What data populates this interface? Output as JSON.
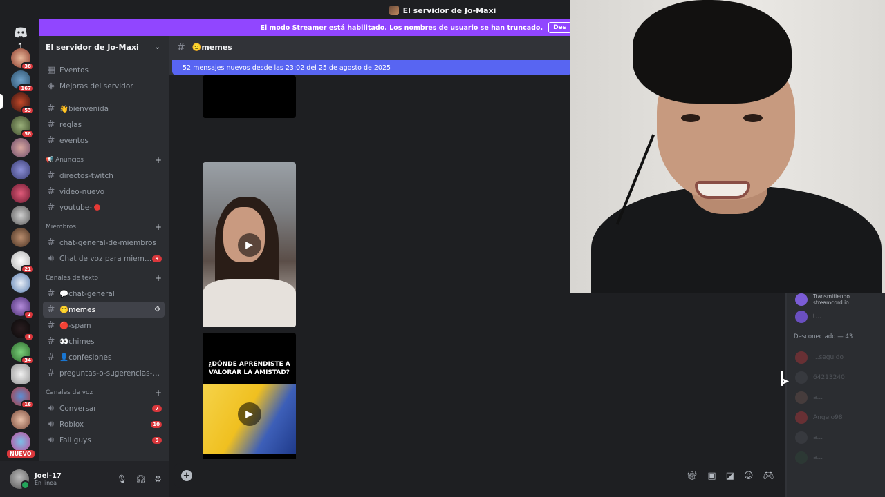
{
  "window": {
    "title": "El servidor de Jo-Maxi"
  },
  "banner": {
    "text": "El modo Streamer está habilitado. Los nombres de usuario se han truncado.",
    "button": "Des"
  },
  "rail": {
    "badges": [
      "1",
      "38",
      "167",
      "53",
      "58",
      "21",
      "2",
      "1",
      "34",
      "16"
    ],
    "new_label": "NUEVO"
  },
  "server": {
    "name": "El servidor de Jo-Maxi"
  },
  "sidebar": {
    "top_items": [
      {
        "label": "Eventos",
        "icon": "calendar-icon"
      },
      {
        "label": "Mejoras del servidor",
        "icon": "boost-icon"
      }
    ],
    "channels_top": [
      {
        "label": "👋bienvenida"
      },
      {
        "label": "reglas"
      },
      {
        "label": "eventos"
      }
    ],
    "categories": {
      "anuncios": "📢 Anuncios",
      "miembros": "Miembros",
      "texto": "Canales de texto",
      "voz": "Canales de voz"
    },
    "anuncios": [
      {
        "label": "directos-twitch"
      },
      {
        "label": "video-nuevo"
      },
      {
        "label": "youtube-"
      }
    ],
    "miembros": [
      {
        "label": "chat-general-de-miembros"
      },
      {
        "label": "Chat de voz para miemb...",
        "badge": "9"
      }
    ],
    "texto": [
      {
        "label": "💬chat-general"
      },
      {
        "label": "🙂memes"
      },
      {
        "label": "🔴-spam"
      },
      {
        "label": "👀chimes"
      },
      {
        "label": "👤confesiones"
      },
      {
        "label": "preguntas-o-sugerencias-pa..."
      }
    ],
    "voz": [
      {
        "label": "Conversar",
        "badge": "7"
      },
      {
        "label": "Roblox",
        "badge": "10"
      },
      {
        "label": "Fall guys",
        "badge": "9"
      }
    ]
  },
  "user": {
    "name": "Joel-17",
    "status": "En línea"
  },
  "channel": {
    "name": "🙂memes"
  },
  "new_messages": "52 mensajes nuevos desde las 23:02 del 25 de agosto de 2025",
  "media": {
    "m3_title": "¿DÓNDE APRENDISTE A VALORAR LA AMISTAD?"
  },
  "members": {
    "streaming": "Transmitiendo streamcord.io",
    "online_name": "t...",
    "offline_header": "Desconectado — 43",
    "offline": [
      {
        "name": "...seguido",
        "color": "#da373c"
      },
      {
        "name": "64213240",
        "color": "#4e5058"
      },
      {
        "name": "a...",
        "color": "#7a5a52"
      },
      {
        "name": "Angelo98",
        "color": "#da373c"
      },
      {
        "name": "a...",
        "color": "#4e5058"
      },
      {
        "name": "a...",
        "color": "#2f4f3a"
      }
    ]
  },
  "colors": {
    "banner": "#9146ff",
    "new_messages": "#5865f2",
    "badge": "#da373c",
    "online": "#23a55a"
  }
}
